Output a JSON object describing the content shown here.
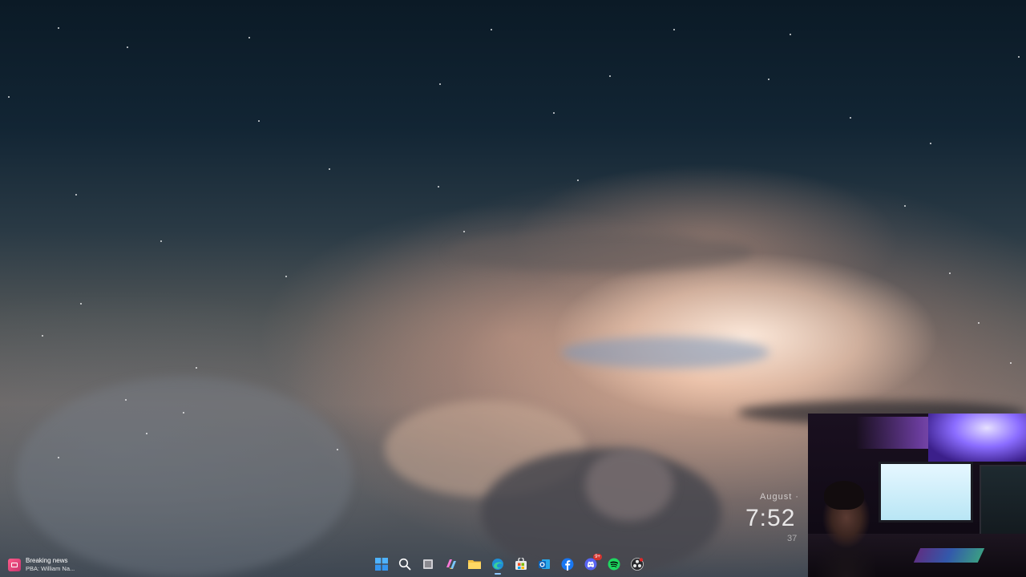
{
  "desktop": {
    "wallpaper": "starry sky with sunset clouds"
  },
  "clock_widget": {
    "date": "August ·",
    "time": "7:52",
    "sub": "37"
  },
  "webcam": {
    "name": "webcam-overlay"
  },
  "taskbar": {
    "news": {
      "title": "Breaking news",
      "subtitle": "PBA: William Na..."
    },
    "apps": [
      {
        "name": "start-icon",
        "color": "#3aa2ff"
      },
      {
        "name": "search-icon",
        "color": "#ffffff"
      },
      {
        "name": "task-view-icon",
        "color": "#d0d0d0"
      },
      {
        "name": "copilot-icon",
        "color": "#ff7ad9"
      },
      {
        "name": "file-explorer-icon",
        "color": "#f5c242"
      },
      {
        "name": "edge-browser-icon",
        "color": "#2ec4a0"
      },
      {
        "name": "microsoft-store-icon",
        "color": "#e9e9e9"
      },
      {
        "name": "outlook-icon",
        "color": "#1a73c8"
      },
      {
        "name": "facebook-icon",
        "color": "#1877f2"
      },
      {
        "name": "discord-icon",
        "color": "#5865f2",
        "badge": "9+"
      },
      {
        "name": "spotify-icon",
        "color": "#1ed760"
      },
      {
        "name": "obs-icon",
        "color": "#2a2a2a"
      }
    ]
  }
}
